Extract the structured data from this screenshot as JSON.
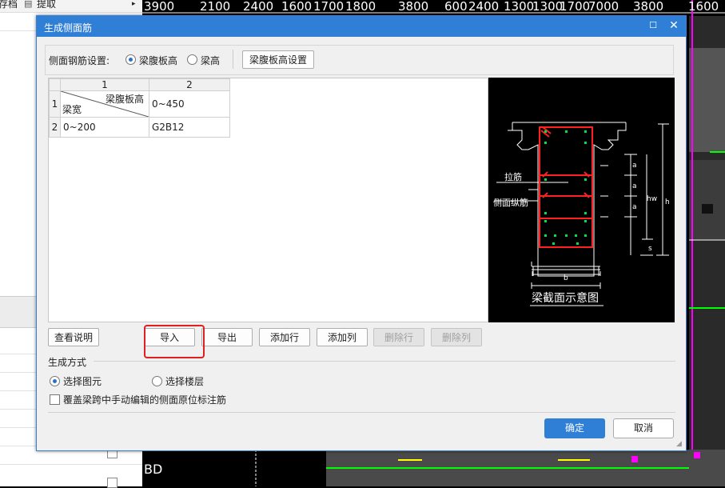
{
  "background": {
    "toolbar_items": [
      "存档",
      "提取"
    ],
    "dimension_labels": [
      "3900",
      "2100",
      "2400",
      "1600",
      "1700",
      "1800",
      "3800",
      "600",
      "2400",
      "1300",
      "1300",
      "1700",
      "7000",
      "3800",
      "1600"
    ],
    "cad_label": "BD"
  },
  "dialog": {
    "title": "生成侧面筋",
    "maximize_icon": "maximize-icon",
    "close_icon": "close-icon",
    "setting": {
      "label": "侧面钢筋设置:",
      "option_web_height": "梁腹板高",
      "option_beam_height": "梁高",
      "selected": "梁腹板高",
      "web_height_settings_button": "梁腹板高设置"
    },
    "table": {
      "col_headers": [
        "1",
        "2"
      ],
      "row_headers": [
        "1",
        "2"
      ],
      "corner_top": "梁腹板高",
      "corner_bottom": "梁宽",
      "rows": [
        [
          "0~450"
        ],
        [
          "0~200",
          "G2B12"
        ]
      ]
    },
    "diagram": {
      "title": "梁截面示意图",
      "label_tie": "拉筋",
      "label_side_bar": "侧面纵筋",
      "label_a": "a",
      "label_hw": "hw",
      "label_h": "h",
      "label_s": "s",
      "label_b": "b"
    },
    "buttons": {
      "view_notes": "查看说明",
      "import": "导入",
      "export": "导出",
      "add_row": "添加行",
      "add_column": "添加列",
      "delete_row": "删除行",
      "delete_column": "删除列"
    },
    "generation": {
      "label": "生成方式",
      "option_select_element": "选择图元",
      "option_select_floor": "选择楼层",
      "selected": "选择图元",
      "override_checkbox": "覆盖梁跨中手动编辑的侧面原位标注筋",
      "override_checked": false
    },
    "ok": "确定",
    "cancel": "取消"
  },
  "colors": {
    "accent": "#2f7fd6",
    "highlight": "#e02020",
    "rebar_red": "#ff2020",
    "rebar_green": "#00e040"
  }
}
